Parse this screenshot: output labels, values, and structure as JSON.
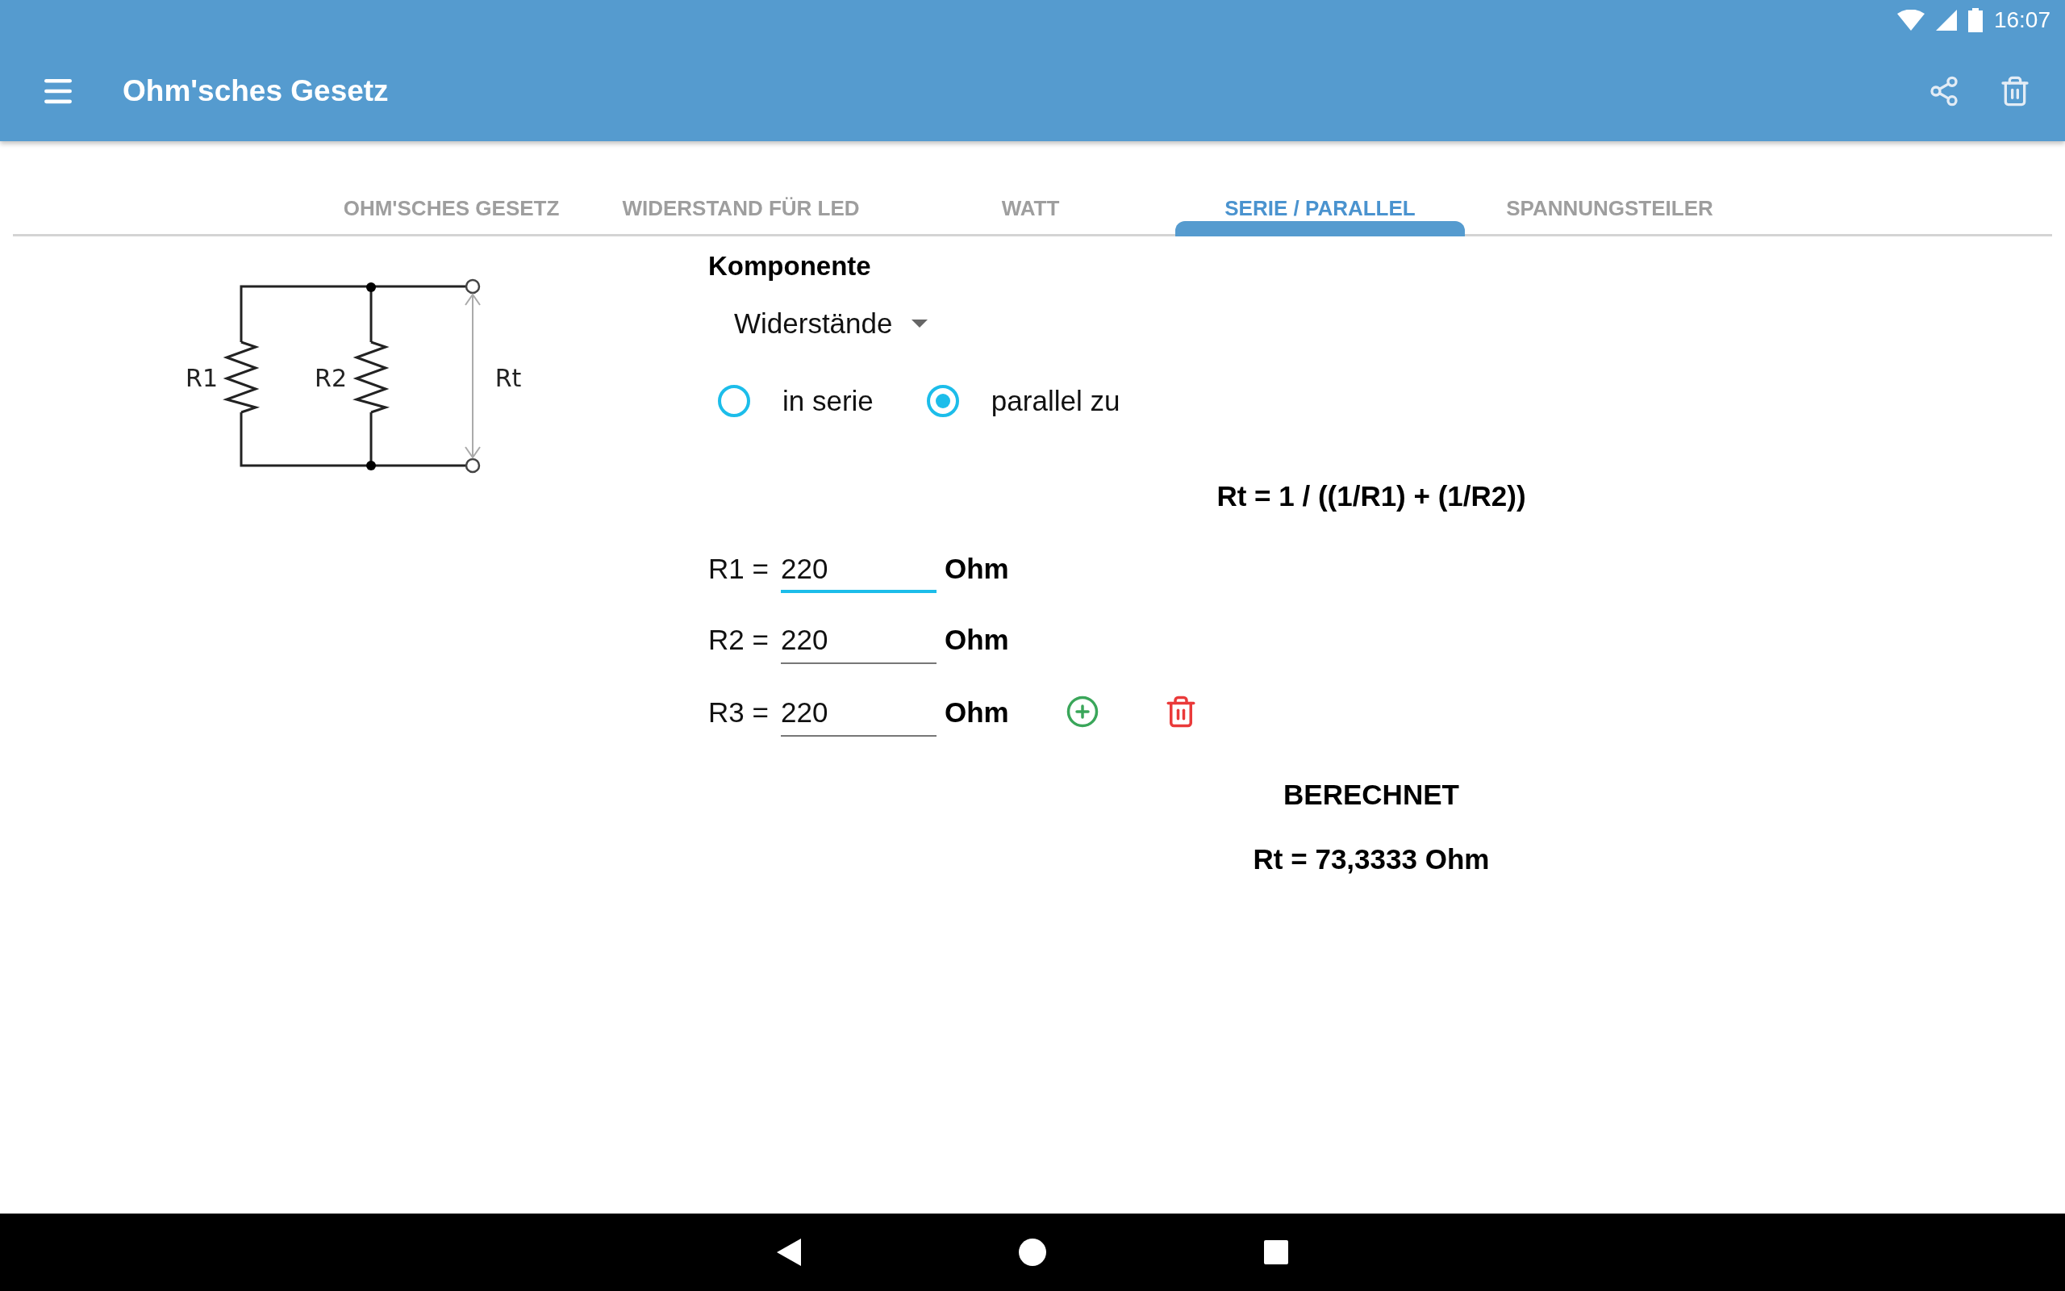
{
  "status_bar": {
    "time": "16:07"
  },
  "app_bar": {
    "title": "Ohm'sches Gesetz"
  },
  "tabs": [
    {
      "label": "OHM'SCHES GESETZ",
      "selected": false
    },
    {
      "label": "WIDERSTAND FÜR LED",
      "selected": false
    },
    {
      "label": "WATT",
      "selected": false
    },
    {
      "label": "SERIE / PARALLEL",
      "selected": true
    },
    {
      "label": "SPANNUNGSTEILER",
      "selected": false
    }
  ],
  "diagram": {
    "labels": [
      "R1",
      "R2",
      "Rt"
    ]
  },
  "component": {
    "label": "Komponente",
    "value": "Widerstände"
  },
  "modes": [
    {
      "label": "in serie",
      "selected": false
    },
    {
      "label": "parallel zu",
      "selected": true
    }
  ],
  "formula": "Rt = 1 / ((1/R1) + (1/R2))",
  "resistors": [
    {
      "label": "R1 =",
      "value": "220",
      "unit": "Ohm",
      "focused": true
    },
    {
      "label": "R2 =",
      "value": "220",
      "unit": "Ohm",
      "focused": false
    },
    {
      "label": "R3 =",
      "value": "220",
      "unit": "Ohm",
      "focused": false
    }
  ],
  "result": {
    "heading": "BERECHNET",
    "value": "Rt = 73,3333 Ohm"
  }
}
